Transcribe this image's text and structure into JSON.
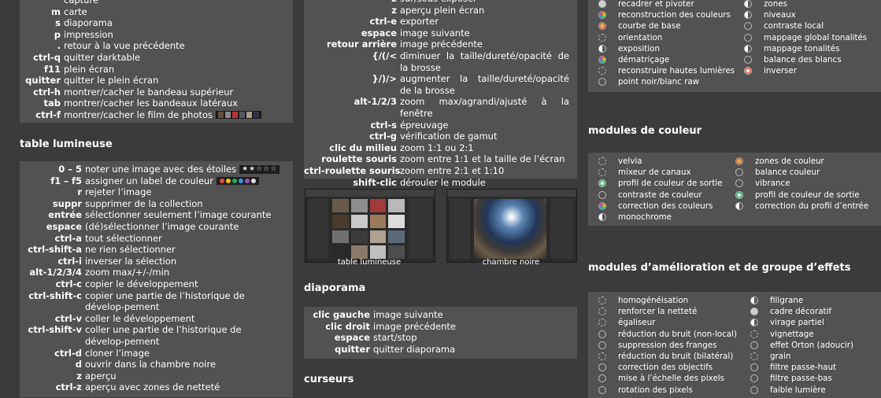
{
  "general": [
    {
      "k": "",
      "v": "capture"
    },
    {
      "k": "m",
      "v": "carte"
    },
    {
      "k": "s",
      "v": "diaporama"
    },
    {
      "k": "p",
      "v": "impression"
    },
    {
      "k": ".",
      "v": "retour à la vue précédente"
    },
    {
      "k": "ctrl-q",
      "v": "quitter darktable"
    },
    {
      "k": "f11",
      "v": "plein écran"
    },
    {
      "k": "quitter",
      "v": "quitter le plein écran"
    },
    {
      "k": "ctrl-h",
      "v": "montrer/cacher le bandeau supérieur"
    },
    {
      "k": "tab",
      "v": "montrer/cacher les bandeaux latéraux"
    },
    {
      "k": "ctrl-f",
      "v": "montrer/cacher le film de photos"
    }
  ],
  "lighttable": {
    "title": "table lumineuse",
    "stars_glyph": "★★☆☆☆",
    "label_colors": [
      "#e74c3c",
      "#f1c40f",
      "#27ae60",
      "#3498db",
      "#9b59b6",
      "#dddddd"
    ],
    "rows": [
      {
        "k": "0 – 5",
        "v": "noter une image avec des étoiles"
      },
      {
        "k": "f1 – f5",
        "v": "assigner un label de couleur"
      },
      {
        "k": "r",
        "v": "rejeter l’image"
      },
      {
        "k": "suppr",
        "v": "supprimer de la collection"
      },
      {
        "k": "entrée",
        "v": "sélectionner seulement l’image courante"
      },
      {
        "k": "espace",
        "v": "(dé)sélectionner l’image courante"
      },
      {
        "k": "ctrl-a",
        "v": "tout sélectionner"
      },
      {
        "k": "ctrl-shift-a",
        "v": "ne rien sélectionner"
      },
      {
        "k": "ctrl-i",
        "v": "inverser la sélection"
      },
      {
        "k": "alt-1/2/3/4",
        "v": "zoom max/+/-/min"
      },
      {
        "k": "ctrl-c",
        "v": "copier le développement"
      },
      {
        "k": "ctrl-shift-c",
        "v": "copier une partie de l’historique de dévelop-pement"
      },
      {
        "k": "ctrl-v",
        "v": "coller le développement"
      },
      {
        "k": "ctrl-shift-v",
        "v": "coller une partie de l’historique de dévelop-pement"
      },
      {
        "k": "ctrl-d",
        "v": "cloner l’image"
      },
      {
        "k": "d",
        "v": "ouvrir dans la chambre noire"
      },
      {
        "k": "z",
        "v": "aperçu"
      },
      {
        "k": "ctrl-z",
        "v": "aperçu avec zones de netteté"
      }
    ]
  },
  "darkroom": [
    {
      "k": "z",
      "v": "sur/sous exposer"
    },
    {
      "k": "z",
      "v": "aperçu plein écran"
    },
    {
      "k": "ctrl-e",
      "v": "exporter"
    },
    {
      "k": "espace",
      "v": "image suivante"
    },
    {
      "k": "retour arrière",
      "v": "image précédente"
    },
    {
      "k": "{/(/<",
      "v": "diminuer la taille/dureté/opacité de la brosse"
    },
    {
      "k": "}/)/>",
      "v": "augmenter la taille/dureté/opacité de la brosse"
    },
    {
      "k": "alt-1/2/3",
      "v": "zoom max/agrandi/ajusté à la fenêtre"
    },
    {
      "k": "ctrl-s",
      "v": "épreuvage"
    },
    {
      "k": "ctrl-g",
      "v": "vérification de gamut"
    },
    {
      "k": "clic du milieu",
      "v": "zoom 1:1 ou 2:1"
    },
    {
      "k": "roulette souris",
      "v": "zoom entre 1:1 et la taille de l’écran"
    },
    {
      "k": "ctrl-roulette souris",
      "v": "zoom entre 2:1 et 1:10"
    },
    {
      "k": "shift-clic",
      "v": "dérouler le module"
    }
  ],
  "screenshots": {
    "lighttable_caption": "table lumineuse",
    "darkroom_caption": "chambre noire"
  },
  "slideshow": {
    "title": "diaporama",
    "rows": [
      {
        "k": "clic gauche",
        "v": "image suivante"
      },
      {
        "k": "clic droit",
        "v": "image précédente"
      },
      {
        "k": "espace",
        "v": "start/stop"
      },
      {
        "k": "quitter",
        "v": "quitter diaporama"
      }
    ]
  },
  "sliders": {
    "title": "curseurs"
  },
  "base_modules": {
    "col1": [
      {
        "icon": "rotate-icon",
        "label": "recadrer et pivoter"
      },
      {
        "icon": "color-reconstruct-icon",
        "label": "reconstruction des couleurs"
      },
      {
        "icon": "base-curve-icon",
        "label": "courbe de base"
      },
      {
        "icon": "orientation-icon",
        "label": "orientation"
      },
      {
        "icon": "exposure-icon",
        "label": "exposition"
      },
      {
        "icon": "demosaic-icon",
        "label": "dématriçage"
      },
      {
        "icon": "highlight-icon",
        "label": "reconstruire hautes lumières"
      },
      {
        "icon": "circle-icon",
        "label": "point noir/blanc raw"
      }
    ],
    "col2": [
      {
        "icon": "zones-icon",
        "label": "zones"
      },
      {
        "icon": "levels-icon",
        "label": "niveaux"
      },
      {
        "icon": "circle-icon",
        "label": "contraste local"
      },
      {
        "icon": "circle-icon",
        "label": "mappage global tonalités"
      },
      {
        "icon": "tonemap-icon",
        "label": "mappage tonalités"
      },
      {
        "icon": "circle-icon",
        "label": "balance des blancs"
      },
      {
        "icon": "invert-icon",
        "label": "inverser"
      }
    ]
  },
  "color_modules": {
    "title": "modules de couleur",
    "col1": [
      {
        "icon": "velvia-icon",
        "label": "velvia"
      },
      {
        "icon": "channel-mixer-icon",
        "label": "mixeur de canaux"
      },
      {
        "icon": "output-profile-icon",
        "label": "profil de couleur de sortie"
      },
      {
        "icon": "circle-icon",
        "label": "contraste de couleur"
      },
      {
        "icon": "color-correction-icon",
        "label": "correction des couleurs"
      },
      {
        "icon": "monochrome-icon",
        "label": "monochrome"
      }
    ],
    "col2": [
      {
        "icon": "color-zones-icon",
        "label": "zones de couleur"
      },
      {
        "icon": "circle-icon",
        "label": "balance couleur"
      },
      {
        "icon": "circle-icon",
        "label": "vibrance"
      },
      {
        "icon": "output-profile-icon",
        "label": "profil de couleur de sortie"
      },
      {
        "icon": "input-profile-icon",
        "label": "correction du profil d’entrée"
      }
    ]
  },
  "enhance_modules": {
    "title": "modules d’amélioration et de groupe d’effets",
    "col1": [
      {
        "icon": "equalize-icon",
        "label": "homogénéisation"
      },
      {
        "icon": "sharpen-icon",
        "label": "renforcer la netteté"
      },
      {
        "icon": "equalizer-icon",
        "label": "égaliseur"
      },
      {
        "icon": "circle-icon",
        "label": "réduction du bruit (non-local)"
      },
      {
        "icon": "circle-icon",
        "label": "suppression des franges"
      },
      {
        "icon": "denoise-icon",
        "label": "réduction du bruit (bilatéral)"
      },
      {
        "icon": "circle-icon",
        "label": "correction des objectifs"
      },
      {
        "icon": "circle-icon",
        "label": "mise à l’échelle des pixels"
      },
      {
        "icon": "circle-icon",
        "label": "rotation des pixels"
      }
    ],
    "col2": [
      {
        "icon": "watermark-icon",
        "label": "filigrane"
      },
      {
        "icon": "frame-icon",
        "label": "cadre décoratif"
      },
      {
        "icon": "split-toning-icon",
        "label": "virage partiel"
      },
      {
        "icon": "vignette-icon",
        "label": "vignettage"
      },
      {
        "icon": "circle-icon",
        "label": "effet Orton (adoucir)"
      },
      {
        "icon": "grain-icon",
        "label": "grain"
      },
      {
        "icon": "circle-icon",
        "label": "filtre passe-haut"
      },
      {
        "icon": "circle-icon",
        "label": "filtre passe-bas"
      },
      {
        "icon": "circle-icon",
        "label": "faible lumière"
      }
    ]
  }
}
